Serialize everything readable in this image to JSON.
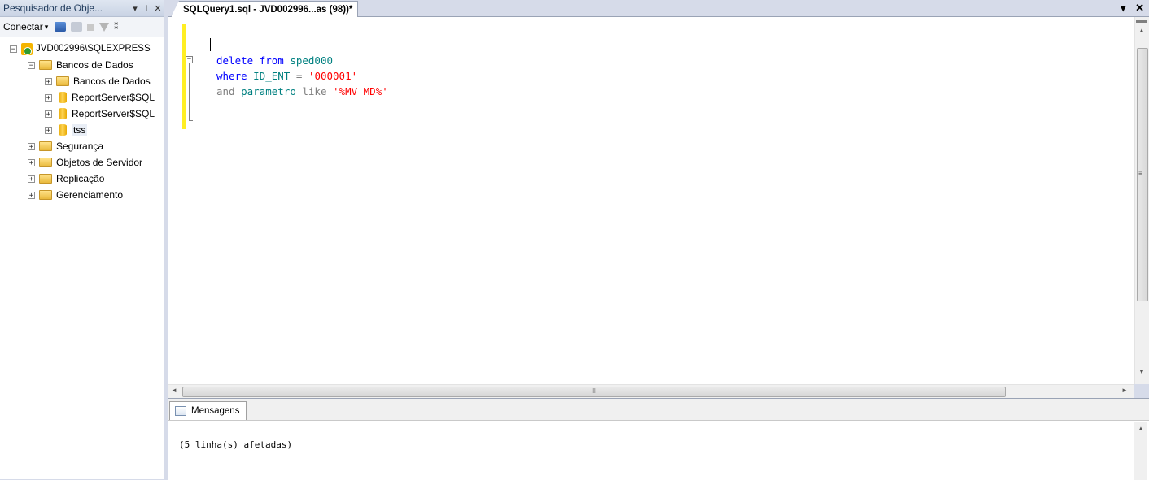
{
  "object_explorer": {
    "title": "Pesquisador de Obje...",
    "pin": "⊥",
    "dropdown": "▾",
    "close": "✕",
    "toolbar": {
      "connect_label": "Conectar",
      "connect_arrow": "▾",
      "overflow": "⁑"
    },
    "tree": {
      "server": "JVD002996\\SQLEXPRESS",
      "databases_folder": "Bancos de Dados",
      "system_databases": "Bancos de Dados",
      "db1": "ReportServer$SQL",
      "db2": "ReportServer$SQL",
      "db3": "tss",
      "security": "Segurança",
      "server_objects": "Objetos de Servidor",
      "replication": "Replicação",
      "management": "Gerenciamento",
      "expanded_glyph": "−",
      "collapsed_glyph": "+"
    }
  },
  "document": {
    "tab_title": "SQLQuery1.sql - JVD002996...as (98))*",
    "dropdown": "▾",
    "close": "✕"
  },
  "code": {
    "line1": {
      "kw1": "delete",
      "kw2": "from",
      "obj": "sped000"
    },
    "line2": {
      "kw": "where",
      "col": "ID_ENT",
      "op": "=",
      "str": "'000001'"
    },
    "line3": {
      "kw": "and",
      "col": "parametro",
      "op": "like",
      "str": "'%MV_MD%'"
    },
    "collapse_glyph": "−"
  },
  "results": {
    "tab_label": "Mensagens",
    "message": "(5 linha(s) afetadas)"
  },
  "scroll": {
    "up": "▲",
    "down": "▼",
    "left": "◄",
    "right": "►",
    "grip_h": "III",
    "grip_v": "≡"
  }
}
